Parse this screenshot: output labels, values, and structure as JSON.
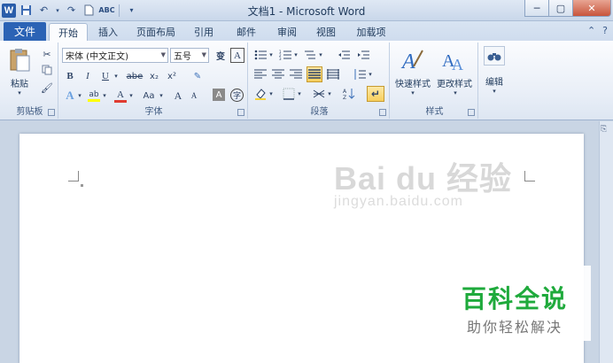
{
  "window": {
    "title": "文档1 - Microsoft Word",
    "minimize": "─",
    "maximize": "▢",
    "close": "✕"
  },
  "qat": {
    "app_icon": "W",
    "icons": [
      "save-icon",
      "undo-icon",
      "redo-icon",
      "new-doc-icon",
      "spelling-icon",
      "customize-qat-icon"
    ]
  },
  "tabs": {
    "file": "文件",
    "items": [
      "开始",
      "插入",
      "页面布局",
      "引用",
      "邮件",
      "审阅",
      "视图",
      "加载项"
    ],
    "active": "开始"
  },
  "ribbon": {
    "clipboard": {
      "label": "剪贴板",
      "paste": "粘贴"
    },
    "font": {
      "label": "字体",
      "font_name": "宋体 (中文正文)",
      "font_size": "五号",
      "bold": "B",
      "italic": "I",
      "underline": "U",
      "strike": "abe",
      "subscript": "x₂",
      "superscript": "x²",
      "change_case": "Aa",
      "grow": "A",
      "shrink": "A",
      "highlight_color": "#ffff00",
      "font_color": "#e03c31"
    },
    "paragraph": {
      "label": "段落"
    },
    "styles": {
      "label": "样式",
      "quick_styles": "快速样式",
      "change_styles": "更改样式"
    },
    "editing": {
      "label": "编辑"
    }
  },
  "document": {
    "watermark": "Bai du 经验",
    "watermark_url": "jingyan.baidu.com"
  },
  "overlay": {
    "brand": "百科全说",
    "tagline": "助你轻松解决",
    "brand_color": "#1faa3c"
  }
}
